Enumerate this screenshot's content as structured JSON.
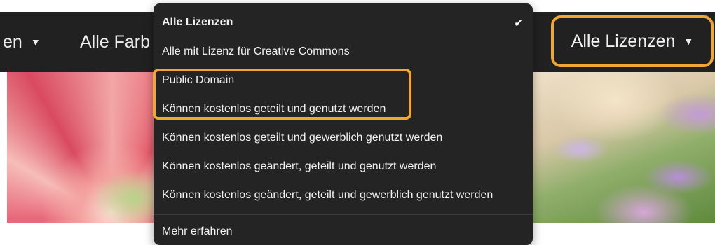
{
  "filter_bar": {
    "left_fragment": "en",
    "colors_label": "Alle Farb",
    "license_label": "Alle Lizenzen",
    "caret": "▼"
  },
  "license_menu": {
    "items": [
      "Alle Lizenzen",
      "Alle mit Lizenz für Creative Commons",
      "Public Domain",
      "Können kostenlos geteilt und genutzt werden",
      "Können kostenlos geteilt und gewerblich genutzt werden",
      "Können kostenlos geändert, geteilt und genutzt werden",
      "Können kostenlos geändert, geteilt und gewerblich genutzt werden"
    ],
    "selected_index": 0,
    "check_icon": "✔",
    "footer_link": "Mehr erfahren"
  },
  "highlight_color": "#f3a631",
  "menu_background": "#242424",
  "bar_background": "#212121"
}
